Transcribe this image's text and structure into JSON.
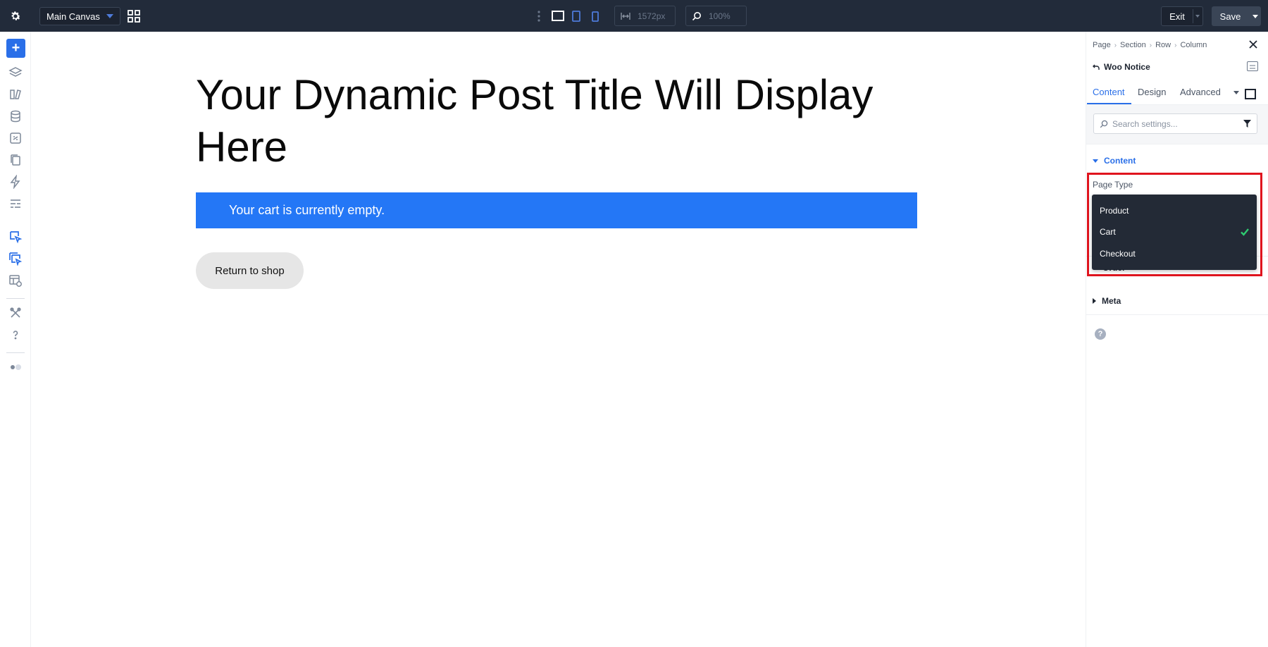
{
  "topbar": {
    "canvas_label": "Main Canvas",
    "width_value": "1572px",
    "zoom_value": "100%",
    "exit_label": "Exit",
    "save_label": "Save"
  },
  "canvas": {
    "post_title": "Your Dynamic Post Title Will Display Here",
    "notice_text": "Your cart is currently empty.",
    "return_button": "Return to shop"
  },
  "panel": {
    "breadcrumbs": [
      "Page",
      "Section",
      "Row",
      "Column"
    ],
    "module_name": "Woo Notice",
    "tabs": [
      "Content",
      "Design",
      "Advanced"
    ],
    "search_placeholder": "Search settings...",
    "section_content": "Content",
    "field_page_type": "Page Type",
    "dropdown_options": [
      {
        "label": "Product",
        "selected": false
      },
      {
        "label": "Cart",
        "selected": true
      },
      {
        "label": "Checkout",
        "selected": false
      }
    ],
    "section_order": "Order",
    "section_meta": "Meta",
    "help_glyph": "?"
  },
  "colors": {
    "topbar_bg": "#222b3a",
    "accent": "#2a6fe8",
    "notice_bg": "#2477f6",
    "highlight": "#e0141e",
    "check": "#2ecc71"
  }
}
